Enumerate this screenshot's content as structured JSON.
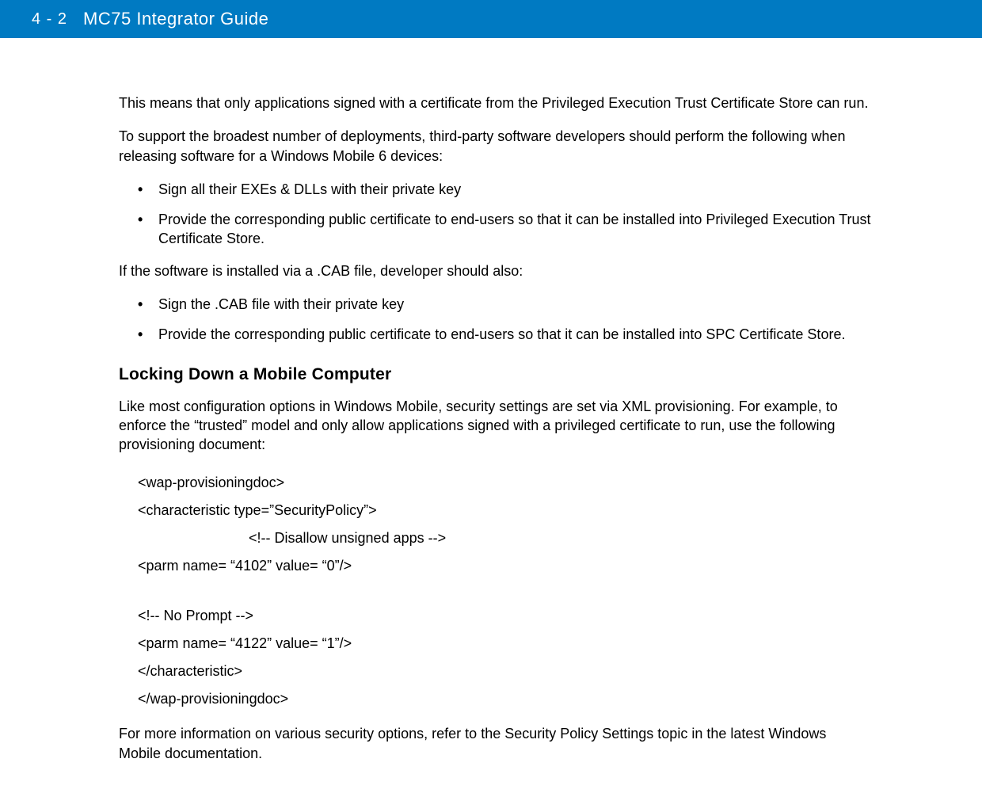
{
  "header": {
    "page_number": "4 - 2",
    "title": "MC75 Integrator Guide"
  },
  "body": {
    "p1": "This means that only applications signed with a certificate from the Privileged Execution Trust Certificate Store can run.",
    "p2": "To support the broadest number of deployments, third-party software developers should perform the following when releasing software for a Windows Mobile 6 devices:",
    "list1": [
      "Sign all their EXEs & DLLs with their private key",
      "Provide the corresponding public certificate to end-users so that it can be installed into Privileged Execution Trust Certificate Store."
    ],
    "p3": "If the software is installed via a .CAB file, developer should also:",
    "list2": [
      "Sign the .CAB file with their private key",
      "Provide the corresponding public certificate to end-users so that it can be installed into SPC Certificate Store."
    ],
    "heading1": "Locking Down a Mobile Computer",
    "p4": "Like most configuration options in Windows Mobile, security settings are set via XML provisioning. For example, to enforce the “trusted” model and only allow applications signed with a privileged certificate to run, use the following provisioning document:",
    "code": {
      "l1": "<wap-provisioningdoc>",
      "l2": "<characteristic type=”SecurityPolicy”>",
      "l3": "<!-- Disallow unsigned apps -->",
      "l4": "<parm name= “4102” value= “0”/>",
      "l5": "<!-- No Prompt -->",
      "l6": "<parm name= “4122” value= “1”/>",
      "l7": "</characteristic>",
      "l8": "</wap-provisioningdoc>"
    },
    "p5": "For more information on various security options, refer to the Security Policy Settings topic in the latest Windows Mobile documentation."
  }
}
